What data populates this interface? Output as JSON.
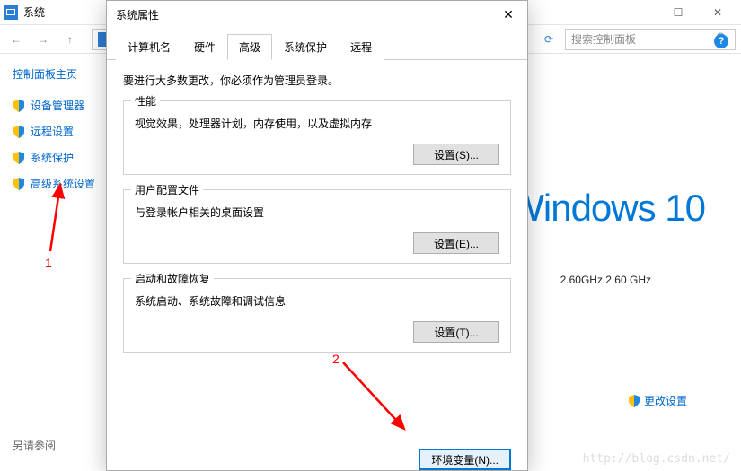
{
  "window": {
    "title": "系统",
    "search_placeholder": "搜索控制面板"
  },
  "sidebar": {
    "home": "控制面板主页",
    "items": [
      {
        "label": "设备管理器"
      },
      {
        "label": "远程设置"
      },
      {
        "label": "系统保护"
      },
      {
        "label": "高级系统设置"
      }
    ],
    "see_also": "另请参阅"
  },
  "main": {
    "os_brand": "Windows 10",
    "cpu": "2.60GHz   2.60 GHz",
    "change_settings": "更改设置",
    "watermark": "http://blog.csdn.net/"
  },
  "dialog": {
    "title": "系统属性",
    "tabs": [
      "计算机名",
      "硬件",
      "高级",
      "系统保护",
      "远程"
    ],
    "note": "要进行大多数更改，你必须作为管理员登录。",
    "groups": {
      "perf": {
        "title": "性能",
        "desc": "视觉效果，处理器计划，内存使用，以及虚拟内存",
        "btn": "设置(S)..."
      },
      "profile": {
        "title": "用户配置文件",
        "desc": "与登录帐户相关的桌面设置",
        "btn": "设置(E)..."
      },
      "startup": {
        "title": "启动和故障恢复",
        "desc": "系统启动、系统故障和调试信息",
        "btn": "设置(T)..."
      }
    },
    "env_btn": "环境变量(N)..."
  },
  "annotations": {
    "n1": "1",
    "n2": "2"
  }
}
